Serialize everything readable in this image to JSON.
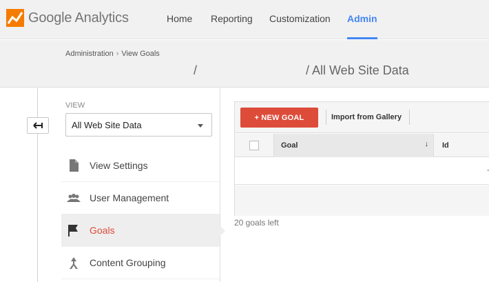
{
  "app": {
    "name": "Google Analytics"
  },
  "nav": {
    "items": [
      {
        "label": "Home"
      },
      {
        "label": "Reporting"
      },
      {
        "label": "Customization"
      },
      {
        "label": "Admin"
      }
    ]
  },
  "breadcrumb": {
    "root": "Administration",
    "separator": "›",
    "current": "View Goals"
  },
  "page_title": {
    "slash": "/",
    "title": "/ All Web Site Data"
  },
  "sidebar": {
    "view_label": "VIEW",
    "view_select_value": "All Web Site Data",
    "items": [
      {
        "label": "View Settings",
        "icon": "document-icon"
      },
      {
        "label": "User Management",
        "icon": "users-icon"
      },
      {
        "label": "Goals",
        "icon": "flag-icon"
      },
      {
        "label": "Content Grouping",
        "icon": "content-grouping-icon"
      }
    ]
  },
  "toolbar": {
    "new_goal_label": "+ NEW GOAL",
    "import_label": "Import from Gallery"
  },
  "table": {
    "columns": [
      "Goal",
      "Id"
    ],
    "sort_indicator": "↓",
    "empty_cell": "-"
  },
  "footer": {
    "goals_left": "20 goals left"
  },
  "colors": {
    "accent": "#4285f4",
    "primary_button": "#dd4b39",
    "active_menu": "#dd4b39"
  }
}
